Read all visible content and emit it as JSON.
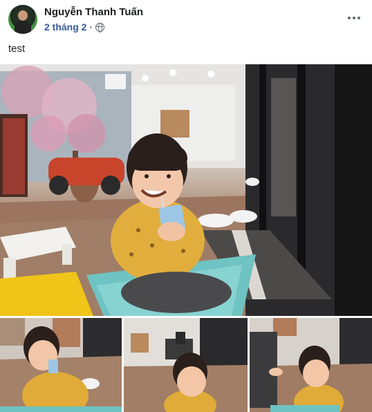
{
  "post": {
    "author_name": "Nguyễn Thanh Tuấn",
    "timestamp": "2 tháng 2",
    "separator": "·",
    "privacy_icon": "globe-icon",
    "more_icon": "more-options-icon",
    "text": "test"
  },
  "photos": {
    "count": 4
  }
}
